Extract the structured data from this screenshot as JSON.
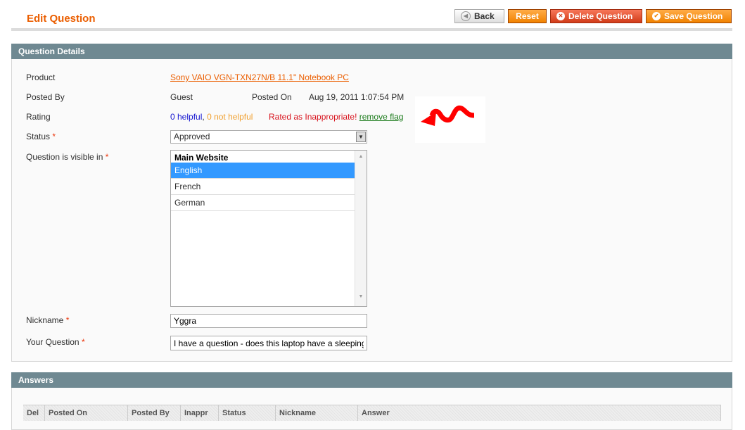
{
  "header": {
    "title": "Edit Question",
    "back": "Back",
    "reset": "Reset",
    "delete": "Delete Question",
    "save": "Save Question"
  },
  "details": {
    "section_title": "Question Details",
    "product_label": "Product",
    "product_value": "Sony VAIO VGN-TXN27N/B 11.1\" Notebook PC",
    "posted_by_label": "Posted By",
    "posted_by_value": "Guest",
    "posted_on_label": "Posted On",
    "posted_on_value": "Aug 19, 2011 1:07:54 PM",
    "rating_label": "Rating",
    "helpful": "0 helpful",
    "comma": ",",
    "not_helpful": "0 not helpful",
    "inappropriate": "Rated as Inappropriate!",
    "remove_flag": "remove flag",
    "status_label": "Status",
    "status_value": "Approved",
    "visible_label": "Question is visible in",
    "visible_group": "Main Website",
    "visible_options": [
      "English",
      "French",
      "German"
    ],
    "nickname_label": "Nickname",
    "nickname_value": "Yggra",
    "question_label": "Your Question",
    "question_value": "I have a question - does this laptop have a sleeping mode?",
    "required_mark": "*"
  },
  "answers": {
    "section_title": "Answers",
    "columns": [
      "Del",
      "Posted On",
      "Posted By",
      "Inappr",
      "Status",
      "Nickname",
      "Answer"
    ]
  },
  "colors": {
    "accent": "#eb5e00",
    "header_bar": "#6f8992",
    "arrow": "#ff0000"
  }
}
